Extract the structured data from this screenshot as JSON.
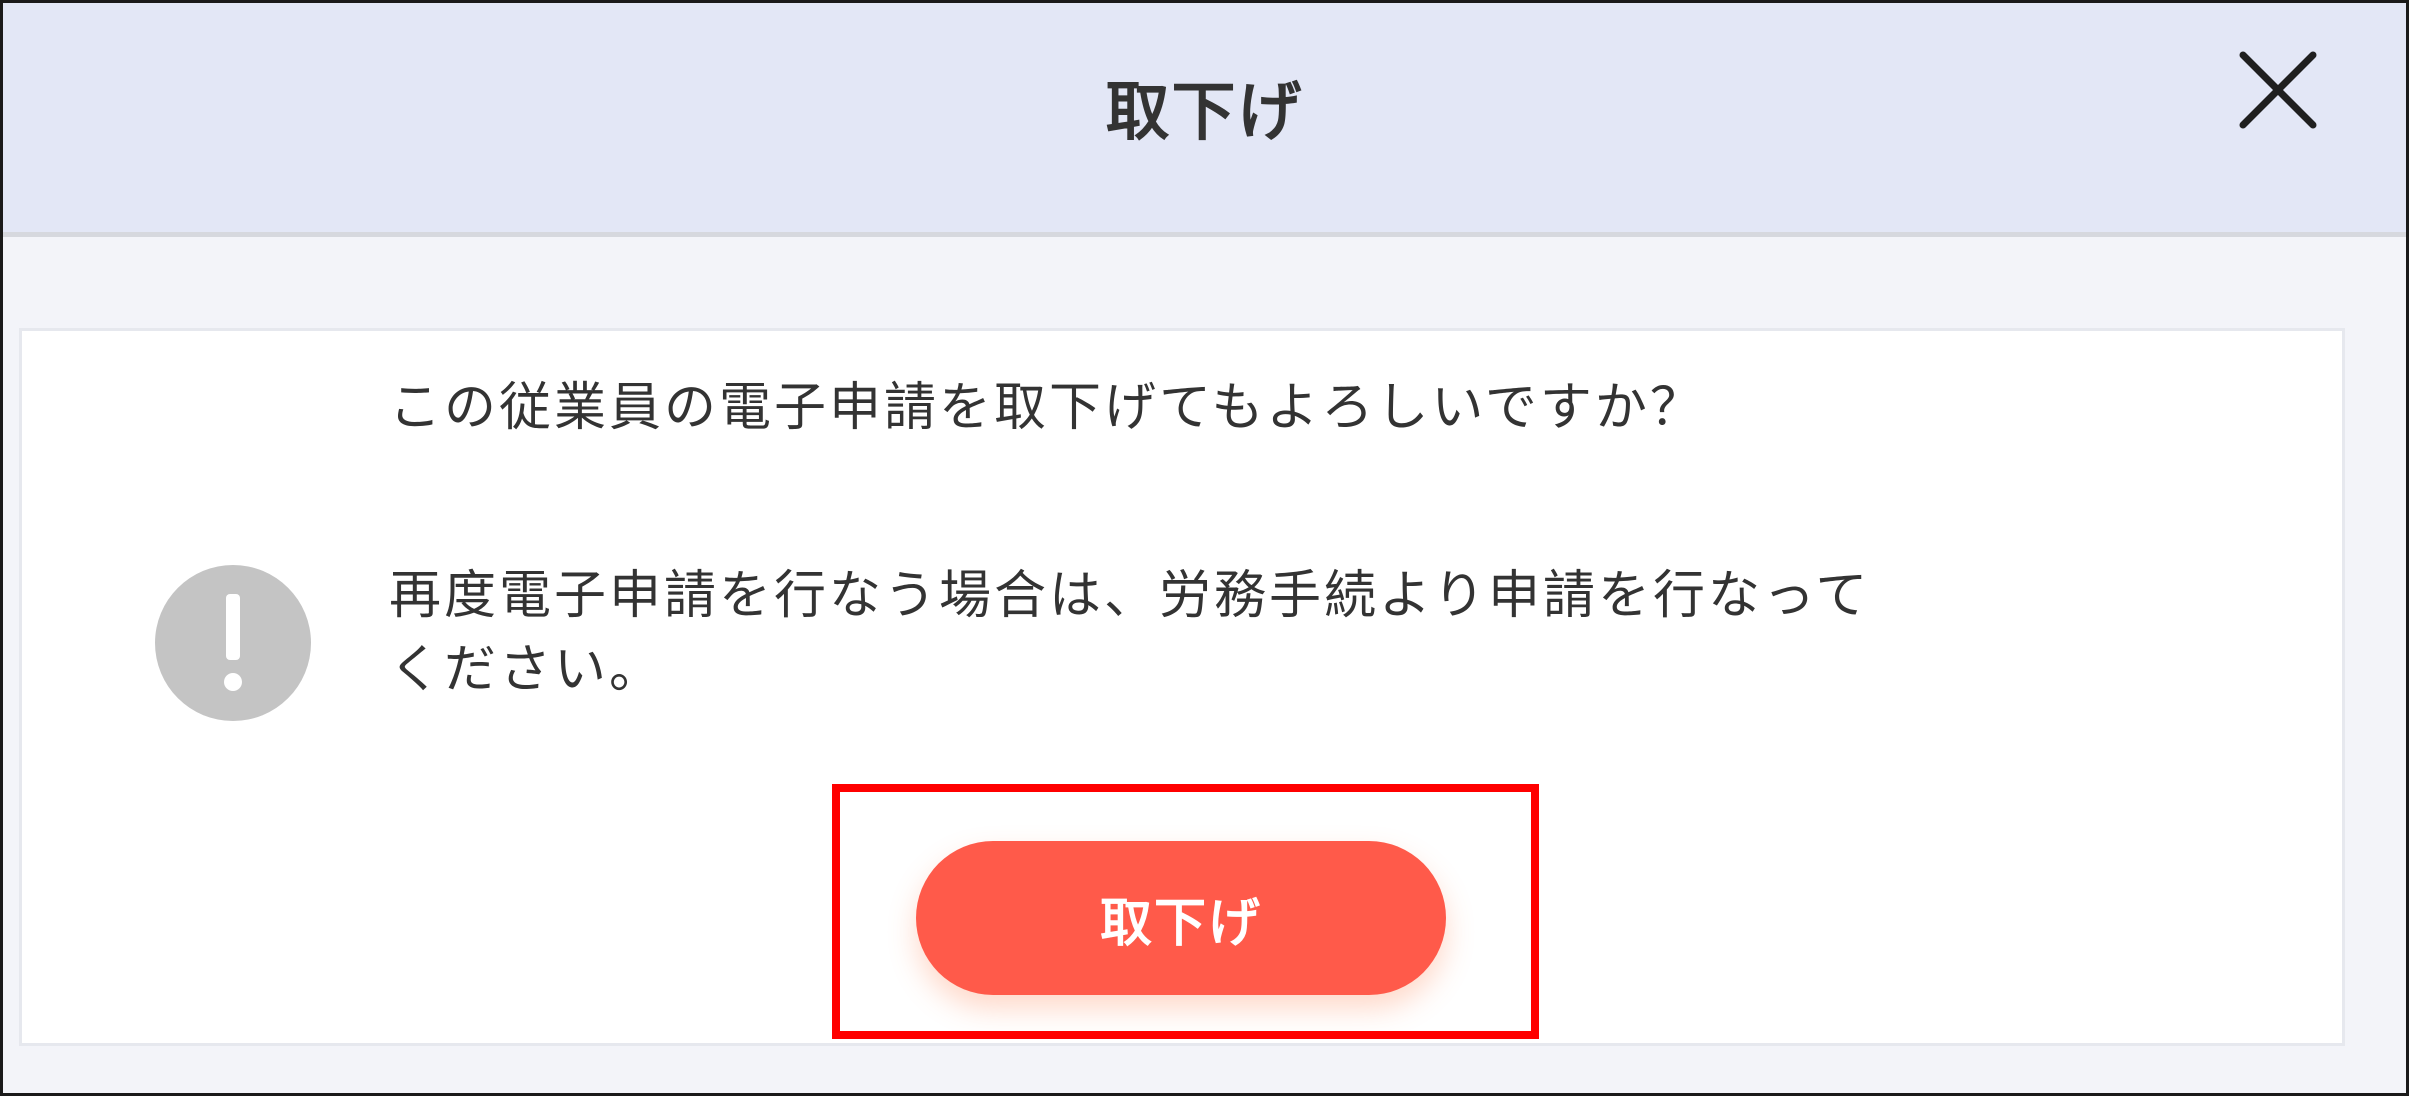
{
  "dialog": {
    "title": "取下げ",
    "close_icon": "close-icon",
    "message_primary": "この従業員の電子申請を取下げてもよろしいですか？",
    "message_secondary": "再度電子申請を行なう場合は、労務手続より申請を行なって\nください。",
    "warning_icon": "exclamation-circle-icon",
    "submit_label": "取下げ"
  },
  "colors": {
    "header_bg": "#e3e7f6",
    "body_bg": "#f3f4f9",
    "button_bg": "#ff5a4a",
    "highlight_border": "#ff0000",
    "warning_icon": "#c4c4c4"
  }
}
